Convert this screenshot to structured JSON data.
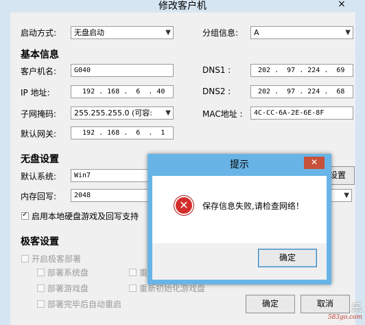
{
  "window": {
    "title": "修改客户机",
    "close_icon": "×"
  },
  "fields": {
    "boot_mode_label": "启动方式:",
    "boot_mode_value": "无盘启动",
    "group_label": "分组信息:",
    "group_value": "A",
    "basic_section": "基本信息",
    "client_name_label": "客户机名:",
    "client_name_value": "G040",
    "ip_label": "IP  地址:",
    "ip_value": "  192 . 168 .  6  . 40",
    "dns1_label": "DNS1    :",
    "dns1_value": " 202 .  97 . 224 .  69",
    "dns2_label": "DNS2    :",
    "dns2_value": " 202 .  97 . 224 .  68",
    "mask_label": "子网掩码:",
    "mask_value": "255.255.255.0  (可容:",
    "mac_label": "MAC地址  :",
    "mac_value": "4C-CC-6A-2E-6E-8F",
    "gateway_label": "默认网关:",
    "gateway_value": "  192 . 168 .  6  .  1"
  },
  "diskless": {
    "section": "无盘设置",
    "system_label": "默认系统:",
    "system_value": "Win7",
    "settings_btn": "设置",
    "cache_label": "内存回写:",
    "cache_value": "2048",
    "local_disk_label": "启用本地硬盘游戏及回写支持"
  },
  "jike": {
    "section": "极客设置",
    "enable_label": "开启极客部署",
    "deploy_system": "部署系统盘",
    "deploy_game": "部署游戏盘",
    "reboot_after": "部署完毕后自动重启",
    "reinit_system_partial": "重",
    "reinit_game": "重新初始化游戏盘"
  },
  "buttons": {
    "ok": "确定",
    "cancel": "取消"
  },
  "dialog": {
    "title": "提示",
    "close_icon": "✕",
    "message": "保存信息失败,请检查网络！",
    "ok": "确定"
  },
  "watermark": {
    "top": "乐",
    "site": "583go.com"
  }
}
